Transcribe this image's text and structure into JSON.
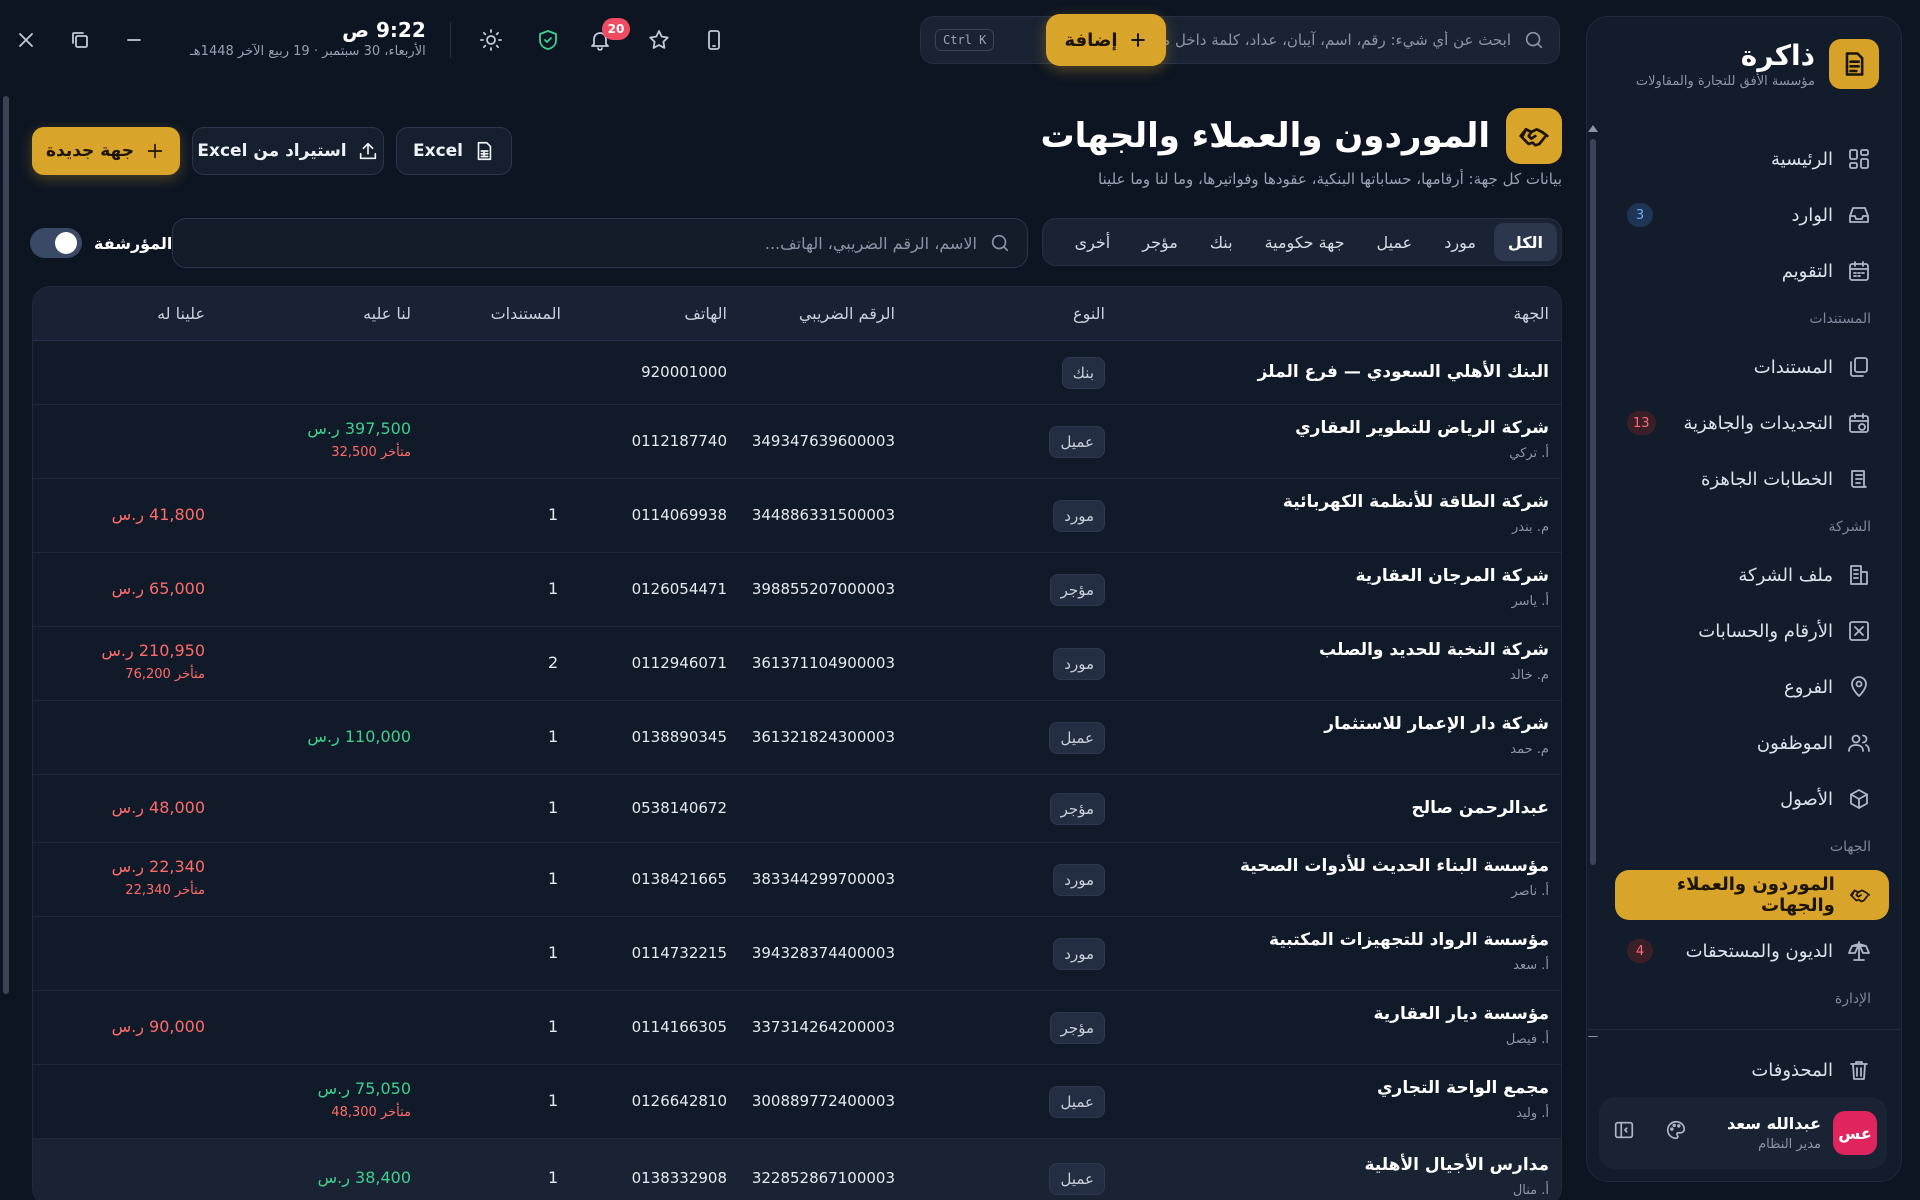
{
  "brand": {
    "name": "ذاكرة",
    "subtitle": "مؤسسة الأفق للتجارة والمقاولات"
  },
  "sidebar": {
    "items": [
      {
        "label": "الرئيسية",
        "icon": "dashboard-icon"
      },
      {
        "label": "الوارد",
        "icon": "inbox-icon",
        "badge": "3"
      },
      {
        "label": "التقويم",
        "icon": "calendar-icon"
      },
      {
        "label": "المستندات",
        "icon": "documents-icon"
      },
      {
        "label": "التجديدات والجاهزية",
        "icon": "renewals-icon",
        "badge": "13"
      },
      {
        "label": "الخطابات الجاهزة",
        "icon": "letters-icon"
      },
      {
        "label": "ملف الشركة",
        "icon": "building-icon"
      },
      {
        "label": "الأرقام والحسابات",
        "icon": "accounts-icon"
      },
      {
        "label": "الفروع",
        "icon": "location-icon"
      },
      {
        "label": "الموظفون",
        "icon": "users-icon"
      },
      {
        "label": "الأصول",
        "icon": "box-icon"
      },
      {
        "label": "الموردون والعملاء والجهات",
        "icon": "handshake-icon",
        "active": true
      },
      {
        "label": "الديون والمستحقات",
        "icon": "scale-icon",
        "badge": "4"
      }
    ],
    "sections": {
      "documents": "المستندات",
      "company": "الشركة",
      "parties": "الجهات",
      "admin": "الإدارة"
    },
    "trash": "المحذوفات",
    "user": {
      "initials": "عس",
      "name": "عبدالله سعد",
      "role": "مدير النظام"
    }
  },
  "topbar": {
    "search_placeholder": "ابحث عن أي شيء: رقم، اسم، آيبان، عداد، كلمة داخل مستند...",
    "shortcut": "Ctrl K",
    "add_label": "إضافة",
    "notifications_count": "20",
    "time": "9:22 ص",
    "date": "الأربعاء، 30 سبتمبر · 19 ربيع الآخر 1448هـ"
  },
  "page": {
    "title": "الموردون والعملاء والجهات",
    "subtitle": "بيانات كل جهة: أرقامها، حساباتها البنكية، عقودها وفواتيرها، وما لنا وما علينا",
    "export_label": "Excel",
    "import_label": "استيراد من Excel",
    "new_label": "جهة جديدة"
  },
  "filters": {
    "tabs": [
      "الكل",
      "مورد",
      "عميل",
      "جهة حكومية",
      "بنك",
      "مؤجر",
      "أخرى"
    ],
    "active": "الكل",
    "search_placeholder": "الاسم، الرقم الضريبي، الهاتف...",
    "archived_label": "المؤرشفة"
  },
  "table": {
    "headers": {
      "name": "الجهة",
      "type": "النوع",
      "tax": "الرقم الضريبي",
      "phone": "الهاتف",
      "docs": "المستندات",
      "owed_to_us": "لنا عليه",
      "owed_by_us": "علينا له"
    },
    "rows": [
      {
        "name": "البنك الأهلي السعودي — فرع الملز",
        "contact": "",
        "type": "بنك",
        "tax": "",
        "phone": "920001000",
        "docs": "",
        "to_us": "",
        "to_us_late": "",
        "by_us": "",
        "by_us_late": ""
      },
      {
        "name": "شركة الرياض للتطوير العقاري",
        "contact": "أ. تركي",
        "type": "عميل",
        "tax": "349347639600003",
        "phone": "0112187740",
        "docs": "",
        "to_us": "397,500 ر.س",
        "to_us_late": "متأخر 32,500",
        "by_us": "",
        "by_us_late": ""
      },
      {
        "name": "شركة الطاقة للأنظمة الكهربائية",
        "contact": "م. بندر",
        "type": "مورد",
        "tax": "344886331500003",
        "phone": "0114069938",
        "docs": "1",
        "to_us": "",
        "to_us_late": "",
        "by_us": "41,800 ر.س",
        "by_us_late": ""
      },
      {
        "name": "شركة المرجان العقارية",
        "contact": "أ. ياسر",
        "type": "مؤجر",
        "tax": "398855207000003",
        "phone": "0126054471",
        "docs": "1",
        "to_us": "",
        "to_us_late": "",
        "by_us": "65,000 ر.س",
        "by_us_late": ""
      },
      {
        "name": "شركة النخبة للحديد والصلب",
        "contact": "م. خالد",
        "type": "مورد",
        "tax": "361371104900003",
        "phone": "0112946071",
        "docs": "2",
        "to_us": "",
        "to_us_late": "",
        "by_us": "210,950 ر.س",
        "by_us_late": "متأخر 76,200"
      },
      {
        "name": "شركة دار الإعمار للاستثمار",
        "contact": "م. حمد",
        "type": "عميل",
        "tax": "361321824300003",
        "phone": "0138890345",
        "docs": "1",
        "to_us": "110,000 ر.س",
        "to_us_late": "",
        "by_us": "",
        "by_us_late": ""
      },
      {
        "name": "عبدالرحمن صالح",
        "contact": "",
        "type": "مؤجر",
        "tax": "",
        "phone": "0538140672",
        "docs": "1",
        "to_us": "",
        "to_us_late": "",
        "by_us": "48,000 ر.س",
        "by_us_late": ""
      },
      {
        "name": "مؤسسة البناء الحديث للأدوات الصحية",
        "contact": "أ. ناصر",
        "type": "مورد",
        "tax": "383344299700003",
        "phone": "0138421665",
        "docs": "1",
        "to_us": "",
        "to_us_late": "",
        "by_us": "22,340 ر.س",
        "by_us_late": "متأخر 22,340"
      },
      {
        "name": "مؤسسة الرواد للتجهيزات المكتبية",
        "contact": "أ. سعد",
        "type": "مورد",
        "tax": "394328374400003",
        "phone": "0114732215",
        "docs": "1",
        "to_us": "",
        "to_us_late": "",
        "by_us": "",
        "by_us_late": ""
      },
      {
        "name": "مؤسسة ديار العقارية",
        "contact": "أ. فيصل",
        "type": "مؤجر",
        "tax": "337314264200003",
        "phone": "0114166305",
        "docs": "1",
        "to_us": "",
        "to_us_late": "",
        "by_us": "90,000 ر.س",
        "by_us_late": ""
      },
      {
        "name": "مجمع الواحة التجاري",
        "contact": "أ. وليد",
        "type": "عميل",
        "tax": "300889772400003",
        "phone": "0126642810",
        "docs": "1",
        "to_us": "75,050 ر.س",
        "to_us_late": "متأخر 48,300",
        "by_us": "",
        "by_us_late": ""
      },
      {
        "name": "مدارس الأجيال الأهلية",
        "contact": "أ. منال",
        "type": "عميل",
        "tax": "322852867100003",
        "phone": "0138332908",
        "docs": "1",
        "to_us": "38,400 ر.س",
        "to_us_late": "",
        "by_us": "",
        "by_us_late": ""
      }
    ]
  },
  "colors": {
    "accent": "#d9a42a",
    "positive": "#3fd08e",
    "negative": "#ff6b6b",
    "badge_red": "#ef4b63"
  }
}
